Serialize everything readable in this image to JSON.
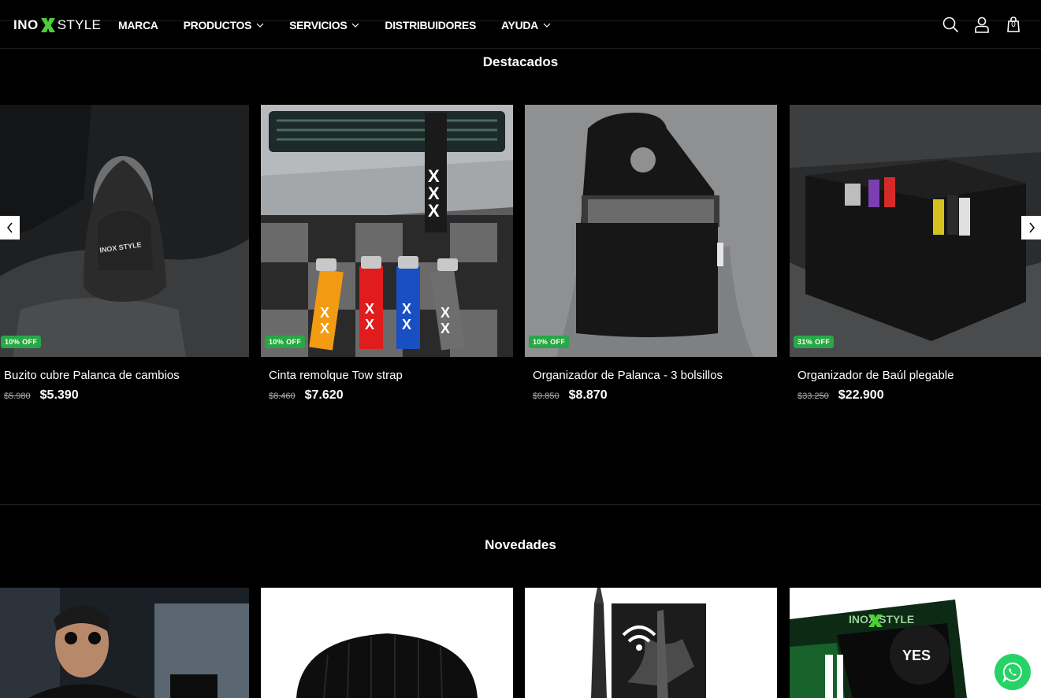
{
  "brand": {
    "ino": "INO",
    "style": "STYLE"
  },
  "nav": {
    "items": [
      {
        "label": "MARCA",
        "dropdown": false
      },
      {
        "label": "PRODUCTOS",
        "dropdown": true
      },
      {
        "label": "SERVICIOS",
        "dropdown": true
      },
      {
        "label": "DISTRIBUIDORES",
        "dropdown": false
      },
      {
        "label": "AYUDA",
        "dropdown": true
      }
    ]
  },
  "header_icons": {
    "search": "search-icon",
    "account": "user-icon",
    "cart": "bag-icon",
    "cart_count": "0"
  },
  "featured": {
    "title": "Destacados",
    "products": [
      {
        "name": "Buzito cubre Palanca de cambios",
        "old_price": "$5.980",
        "price": "$5.390",
        "badge": "10% OFF"
      },
      {
        "name": "Cinta remolque Tow strap",
        "old_price": "$8.460",
        "price": "$7.620",
        "badge": "10% OFF"
      },
      {
        "name": "Organizador de Palanca - 3 bolsillos",
        "old_price": "$9.850",
        "price": "$8.870",
        "badge": "10% OFF"
      },
      {
        "name": "Organizador de Baúl plegable",
        "old_price": "$33.250",
        "price": "$22.900",
        "badge": "31% OFF"
      }
    ]
  },
  "new_arrivals": {
    "title": "Novedades",
    "sticker_text": "YES"
  },
  "colors": {
    "accent_green": "#28a745",
    "logo_green": "#4cd137",
    "whatsapp": "#25d366"
  }
}
